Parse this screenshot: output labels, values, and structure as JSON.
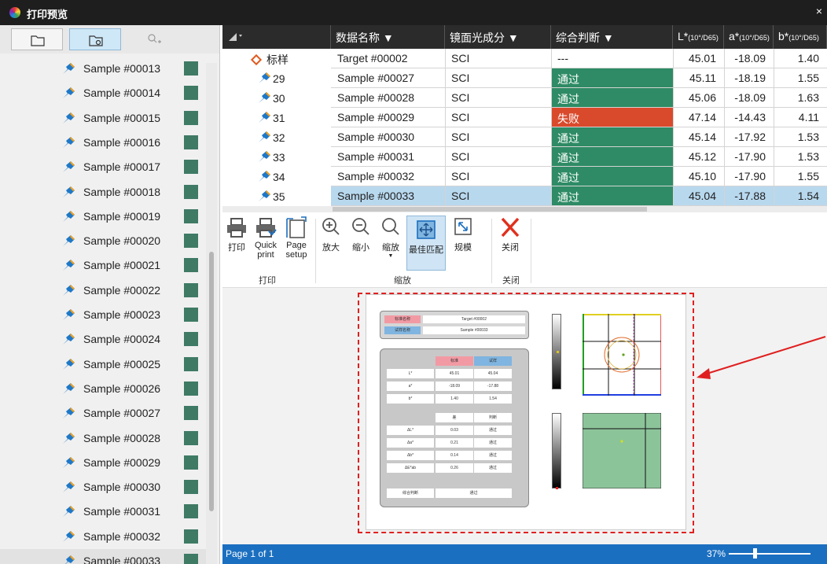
{
  "window": {
    "title": "打印预览",
    "close_label": "×"
  },
  "sidebar": {
    "items": [
      "Sample #00013",
      "Sample #00014",
      "Sample #00015",
      "Sample #00016",
      "Sample #00017",
      "Sample #00018",
      "Sample #00019",
      "Sample #00020",
      "Sample #00021",
      "Sample #00022",
      "Sample #00023",
      "Sample #00024",
      "Sample #00025",
      "Sample #00026",
      "Sample #00027",
      "Sample #00028",
      "Sample #00029",
      "Sample #00030",
      "Sample #00031",
      "Sample #00032",
      "Sample #00033"
    ],
    "swatch_color": "#3f7a65"
  },
  "table": {
    "headers": {
      "name": "数据名称 ▼",
      "specular": "镜面光成分 ▼",
      "judgement": "综合判断 ▼",
      "L": "L*",
      "L_sub": "(10°/D65)",
      "a": "a*",
      "a_sub": "(10°/D65)",
      "b": "b*",
      "b_sub": "(10°/D65)"
    },
    "rows": [
      {
        "id": "标样",
        "name": "Target #00002",
        "spec": "SCI",
        "judge": "---",
        "status": "none",
        "L": "45.01",
        "a": "-18.09",
        "b": "1.40"
      },
      {
        "id": "29",
        "name": "Sample #00027",
        "spec": "SCI",
        "judge": "通过",
        "status": "pass",
        "L": "45.11",
        "a": "-18.19",
        "b": "1.55"
      },
      {
        "id": "30",
        "name": "Sample #00028",
        "spec": "SCI",
        "judge": "通过",
        "status": "pass",
        "L": "45.06",
        "a": "-18.09",
        "b": "1.63"
      },
      {
        "id": "31",
        "name": "Sample #00029",
        "spec": "SCI",
        "judge": "失败",
        "status": "fail",
        "L": "47.14",
        "a": "-14.43",
        "b": "4.11"
      },
      {
        "id": "32",
        "name": "Sample #00030",
        "spec": "SCI",
        "judge": "通过",
        "status": "pass",
        "L": "45.14",
        "a": "-17.92",
        "b": "1.53"
      },
      {
        "id": "33",
        "name": "Sample #00031",
        "spec": "SCI",
        "judge": "通过",
        "status": "pass",
        "L": "45.12",
        "a": "-17.90",
        "b": "1.53"
      },
      {
        "id": "34",
        "name": "Sample #00032",
        "spec": "SCI",
        "judge": "通过",
        "status": "pass",
        "L": "45.10",
        "a": "-17.90",
        "b": "1.55"
      },
      {
        "id": "35",
        "name": "Sample #00033",
        "spec": "SCI",
        "judge": "通过",
        "status": "pass",
        "L": "45.04",
        "a": "-17.88",
        "b": "1.54"
      }
    ],
    "colors": {
      "pass": "#2e8b65",
      "fail": "#d94a2c",
      "selected": "#b8d8ee"
    }
  },
  "ribbon": {
    "print": "打印",
    "quick_print_1": "Quick",
    "quick_print_2": "print",
    "page_setup_1": "Page",
    "page_setup_2": "setup",
    "group_print": "打印",
    "zoom_in": "放大",
    "zoom_out": "缩小",
    "zoom": "缩放",
    "best_fit": "最佳匹配",
    "scale": "规模",
    "group_zoom": "缩放",
    "close": "关闭",
    "group_close": "关闭"
  },
  "preview": {
    "target_label": "标准名称",
    "sample_label": "试样名称",
    "target_value": "Target #00002",
    "sample_value": "Sample #00033",
    "col_target": "标准",
    "col_sample": "试样",
    "rows": [
      {
        "k": "L*",
        "t": "45.01",
        "s": "45.04"
      },
      {
        "k": "a*",
        "t": "-18.09",
        "s": "-17.88"
      },
      {
        "k": "b*",
        "t": "1.40",
        "s": "1.54"
      }
    ],
    "diff_head1": "差",
    "diff_head2": "判断",
    "diffs": [
      {
        "k": "ΔL*",
        "v": "0.03",
        "j": "通过"
      },
      {
        "k": "Δa*",
        "v": "0.21",
        "j": "通过"
      },
      {
        "k": "Δb*",
        "v": "0.14",
        "j": "通过"
      },
      {
        "k": "ΔE*ab",
        "v": "0.26",
        "j": "通过"
      }
    ],
    "overall_label": "综合判断",
    "overall_value": "通过"
  },
  "status": {
    "page": "Page 1 of 1",
    "zoom": "37%",
    "zoom_percent": 37
  }
}
